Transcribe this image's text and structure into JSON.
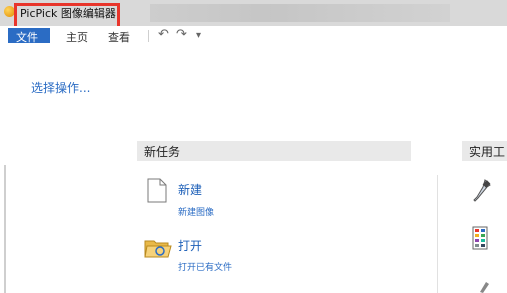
{
  "window": {
    "title": "PicPick 图像编辑器"
  },
  "ribbon": {
    "file_label": "文件",
    "tabs": [
      "主页",
      "查看"
    ],
    "undo_glyph": "↶",
    "redo_glyph": "↷",
    "customize_glyph": "▾"
  },
  "left_panel": {
    "prompt": "选择操作..."
  },
  "new_task": {
    "header": "新任务",
    "items": [
      {
        "title": "新建",
        "subtitle": "新建图像",
        "icon": "document-icon"
      },
      {
        "title": "打开",
        "subtitle": "打开已有文件",
        "icon": "folder-open-icon"
      }
    ]
  },
  "utilities": {
    "header": "实用工",
    "icons": [
      "eyedropper-icon",
      "color-palette-icon",
      "tool-icon"
    ]
  },
  "colors": {
    "accent": "#2b6cc4",
    "highlight": "#e8352b",
    "header_bg": "#e9e9e9"
  }
}
